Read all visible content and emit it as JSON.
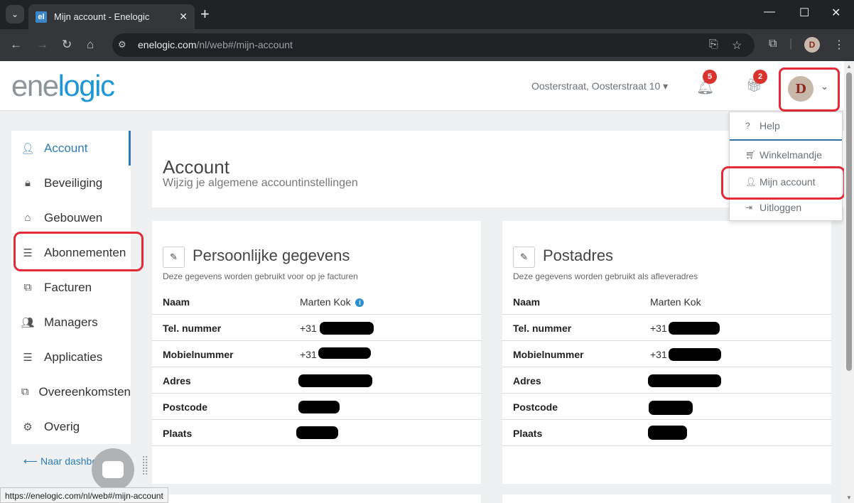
{
  "browser": {
    "tab_title": "Mijn account - Enelogic",
    "favicon_text": "el",
    "url_domain": "enelogic.com",
    "url_path": "/nl/web#/mijn-account",
    "status_url": "https://enelogic.com/nl/web#/mijn-account",
    "profile_initial": "D"
  },
  "header": {
    "logo_part1": "ene",
    "logo_part2": "logic",
    "address": "Oosterstraat, Oosterstraat 10",
    "notifications_count": "5",
    "gifts_count": "2",
    "avatar_initial": "D"
  },
  "user_menu": {
    "items": [
      {
        "label": "Help",
        "icon": "question-icon"
      },
      {
        "label": "Winkelmandje",
        "icon": "cart-icon"
      },
      {
        "label": "Mijn account",
        "icon": "user-icon"
      },
      {
        "label": "Uitloggen",
        "icon": "logout-icon"
      }
    ]
  },
  "sidebar": {
    "items": [
      {
        "label": "Account",
        "icon": "user-icon",
        "active": true
      },
      {
        "label": "Beveiliging",
        "icon": "lock-icon"
      },
      {
        "label": "Gebouwen",
        "icon": "home-icon"
      },
      {
        "label": "Abonnementen",
        "icon": "list-icon"
      },
      {
        "label": "Facturen",
        "icon": "copy-icon"
      },
      {
        "label": "Managers",
        "icon": "users-icon"
      },
      {
        "label": "Applicaties",
        "icon": "list-icon"
      },
      {
        "label": "Overeenkomsten",
        "icon": "copy-icon"
      },
      {
        "label": "Overig",
        "icon": "gears-icon"
      }
    ],
    "back_link": "Naar dashbo"
  },
  "page": {
    "title": "Account",
    "subtitle": "Wijzig je algemene accountinstellingen"
  },
  "personal": {
    "title": "Persoonlijke gegevens",
    "subtitle": "Deze gegevens worden gebruikt voor op je facturen",
    "rows": [
      {
        "label": "Naam",
        "value": "Marten Kok"
      },
      {
        "label": "Tel. nummer",
        "value": "+31"
      },
      {
        "label": "Mobielnummer",
        "value": "+31"
      },
      {
        "label": "Adres",
        "value": ""
      },
      {
        "label": "Postcode",
        "value": ""
      },
      {
        "label": "Plaats",
        "value": ""
      }
    ]
  },
  "postal": {
    "title": "Postadres",
    "subtitle": "Deze gegevens worden gebruikt als afleveradres",
    "rows": [
      {
        "label": "Naam",
        "value": "Marten Kok"
      },
      {
        "label": "Tel. nummer",
        "value": "+31"
      },
      {
        "label": "Mobielnummer",
        "value": "+31"
      },
      {
        "label": "Adres",
        "value": ""
      },
      {
        "label": "Postcode",
        "value": ""
      },
      {
        "label": "Plaats",
        "value": ""
      }
    ]
  },
  "colors": {
    "accent": "#2d7cb7",
    "logo_blue": "#1e97d4",
    "badge_red": "#d9322f",
    "highlight": "#e32a36"
  }
}
